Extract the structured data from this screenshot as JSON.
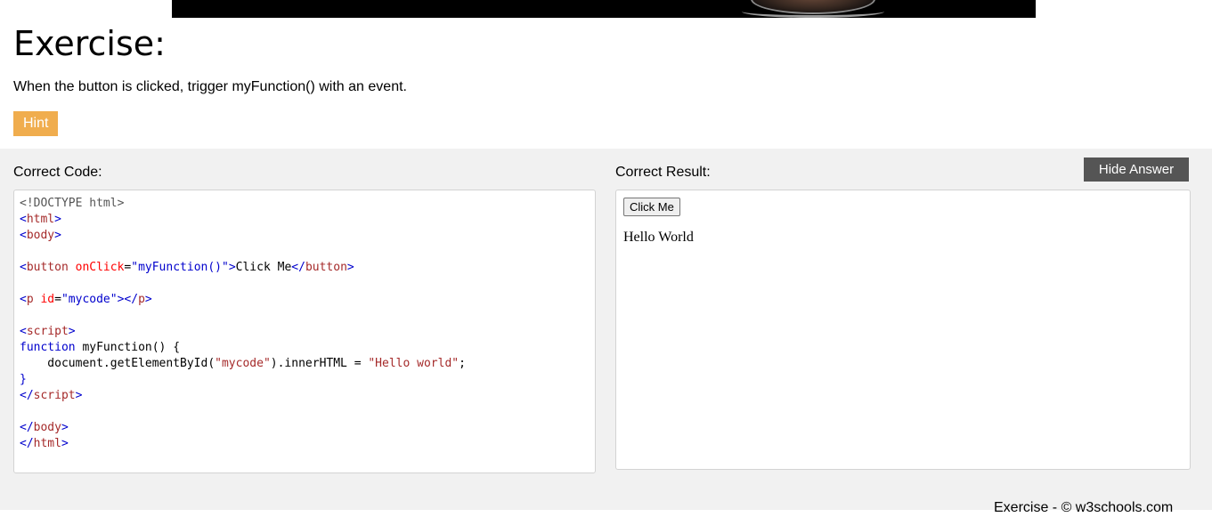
{
  "exercise": {
    "title": "Exercise:",
    "instruction": "When the button is clicked, trigger myFunction() with an event.",
    "hint_label": "Hint"
  },
  "answer": {
    "code_label": "Correct Code:",
    "result_label": "Correct Result:",
    "hide_answer_label": "Hide Answer",
    "code": {
      "doctype": "<!DOCTYPE html>",
      "html_open": "html",
      "body_open": "body",
      "button_tag": "button",
      "button_attr": "onClick",
      "button_attr_val": "\"myFunction()\"",
      "button_text": "Click Me",
      "p_tag": "p",
      "p_attr": "id",
      "p_attr_val": "\"mycode\"",
      "script_tag": "script",
      "func_keyword": "function",
      "func_decl": " myFunction() {",
      "stmt_start": "    document.getElementById(",
      "stmt_arg": "\"mycode\"",
      "stmt_mid": ").innerHTML = ",
      "stmt_str": "\"Hello world\"",
      "stmt_end": ";",
      "brace_close": "}",
      "body_close": "body",
      "html_close": "html"
    },
    "result": {
      "button_label": "Click Me",
      "output_text": "Hello World"
    }
  },
  "footer": {
    "credit": "Exercise - © w3schools.com"
  },
  "colors": {
    "hint_bg": "#f0ad4e",
    "hide_answer_bg": "#555555",
    "answer_area_bg": "#f1f1f1",
    "code_tag": "#a52a2a",
    "code_attr": "#ff0000",
    "code_value": "#0000cd"
  }
}
